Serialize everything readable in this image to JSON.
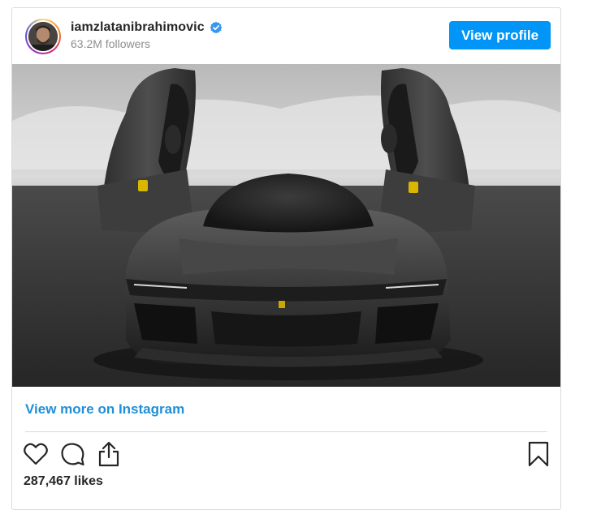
{
  "header": {
    "username": "iamzlatanibrahimovic",
    "followers": "63.2M followers",
    "view_profile_label": "View profile"
  },
  "media": {
    "alt": "Black Ferrari supercar with scissor doors open"
  },
  "view_more": {
    "label": "View more on Instagram"
  },
  "actions": {
    "icons": [
      "heart-icon",
      "comment-icon",
      "share-icon",
      "bookmark-icon"
    ]
  },
  "likes": "287,467 likes",
  "colors": {
    "accent": "#0095f6",
    "link": "#1e8fd8",
    "verified": "#3897f0",
    "border": "#dbdbdb",
    "muted": "#8e8e8e"
  }
}
